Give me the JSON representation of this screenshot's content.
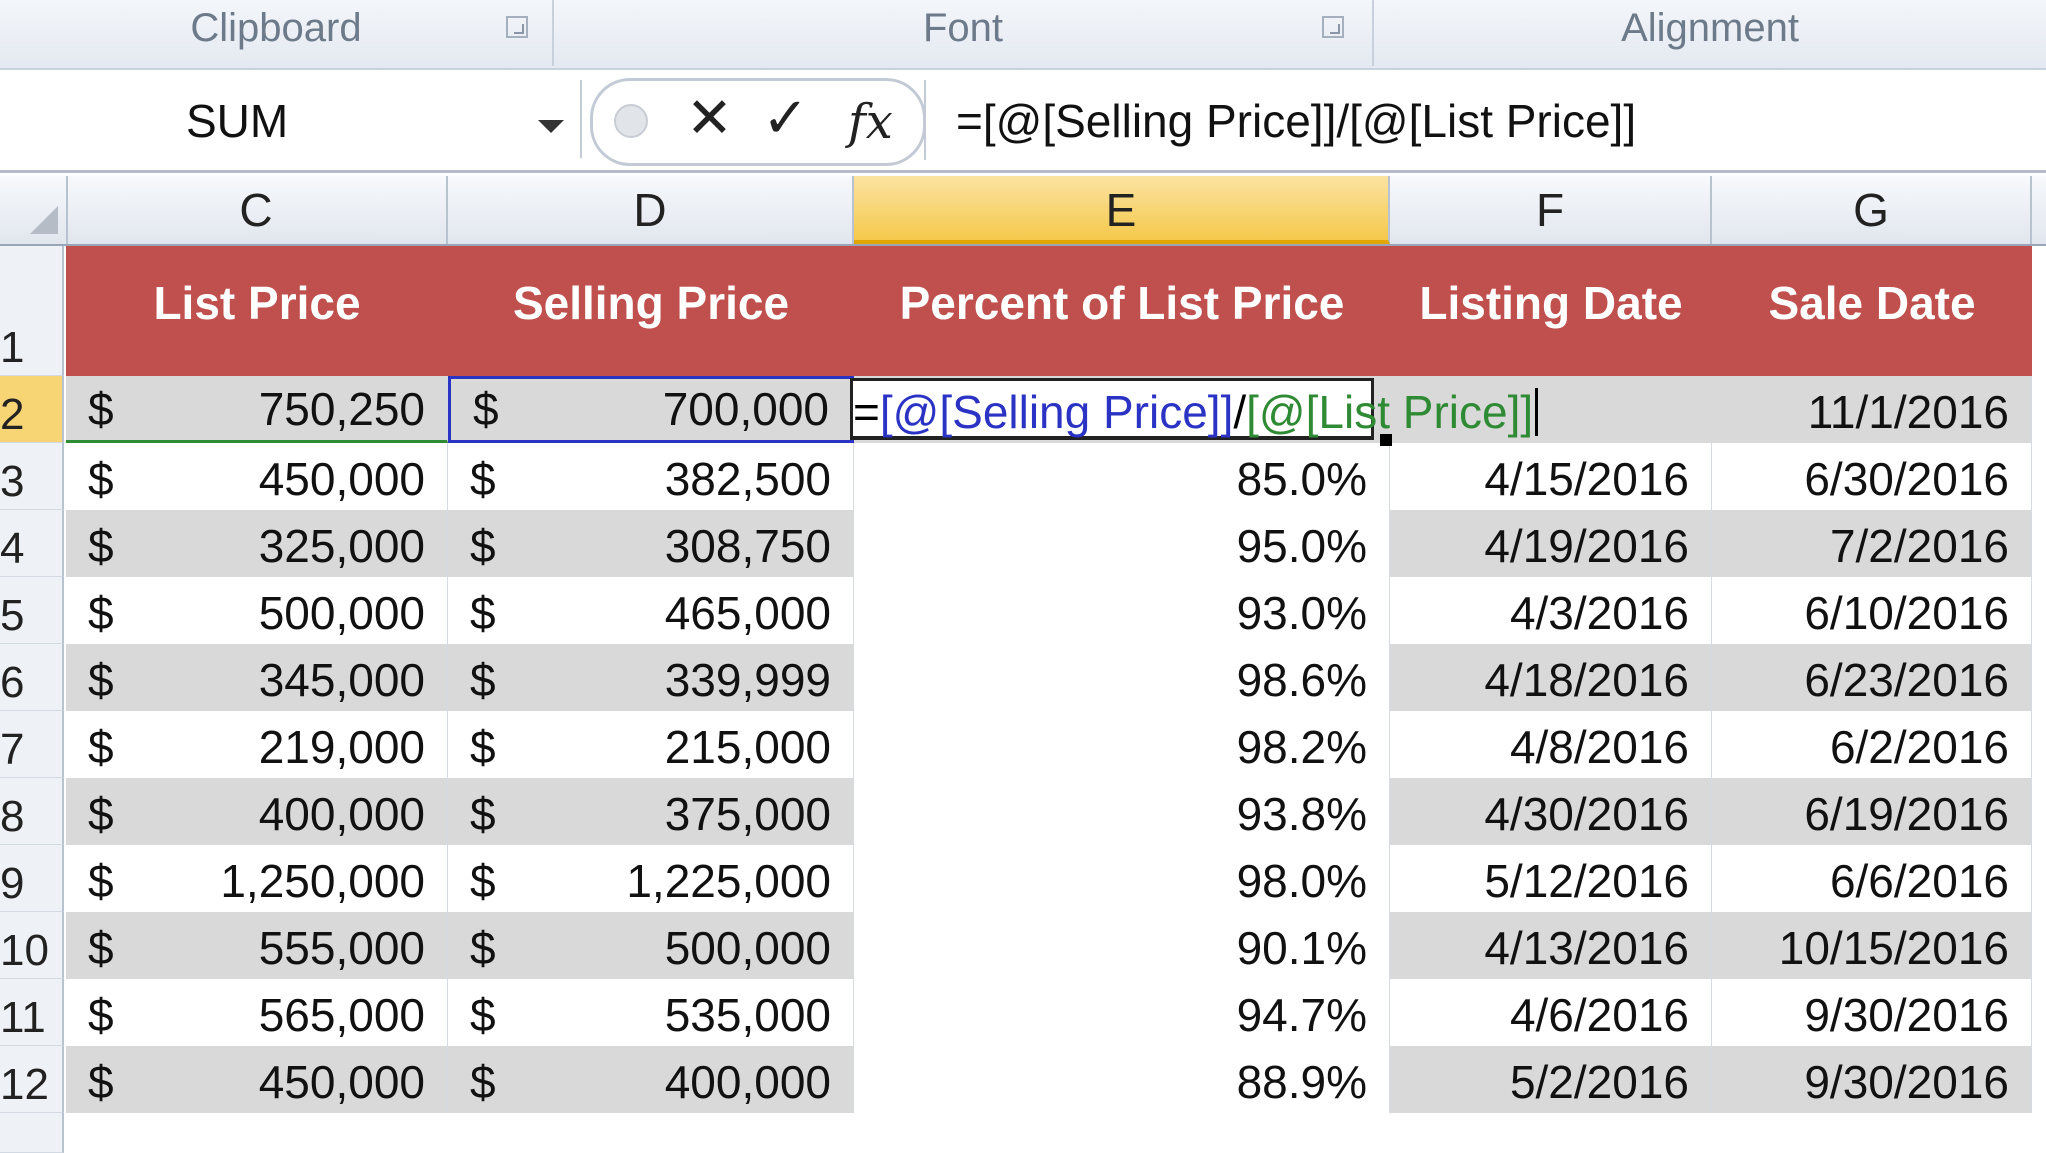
{
  "ribbon": {
    "groups": [
      {
        "label": "Clipboard"
      },
      {
        "label": "Font"
      },
      {
        "label": "Alignment"
      }
    ]
  },
  "formula_bar": {
    "name_box": "SUM",
    "cancel_symbol": "✕",
    "enter_symbol": "✓",
    "fx_symbol": "fx",
    "formula": "=[@[Selling Price]]/[@[List Price]]"
  },
  "columns": [
    "C",
    "D",
    "E",
    "F",
    "G"
  ],
  "active_column": "E",
  "table": {
    "header_color": "#c0504d",
    "band_color": "#d9d9d9",
    "headers": [
      "List Price",
      "Selling Price",
      "Percent of List Price",
      "Listing Date",
      "Sale Date"
    ],
    "edit_cell": {
      "eq": "=",
      "ref1": "[@[Selling Price]]",
      "div": "/",
      "ref2": "[@[List Price]]"
    },
    "rows": [
      {
        "row": "2",
        "list": "750,250",
        "selling": "700,000",
        "pct": "",
        "listing": "",
        "sale": "11/1/2016"
      },
      {
        "row": "3",
        "list": "450,000",
        "selling": "382,500",
        "pct": "85.0%",
        "listing": "4/15/2016",
        "sale": "6/30/2016"
      },
      {
        "row": "4",
        "list": "325,000",
        "selling": "308,750",
        "pct": "95.0%",
        "listing": "4/19/2016",
        "sale": "7/2/2016"
      },
      {
        "row": "5",
        "list": "500,000",
        "selling": "465,000",
        "pct": "93.0%",
        "listing": "4/3/2016",
        "sale": "6/10/2016"
      },
      {
        "row": "6",
        "list": "345,000",
        "selling": "339,999",
        "pct": "98.6%",
        "listing": "4/18/2016",
        "sale": "6/23/2016"
      },
      {
        "row": "7",
        "list": "219,000",
        "selling": "215,000",
        "pct": "98.2%",
        "listing": "4/8/2016",
        "sale": "6/2/2016"
      },
      {
        "row": "8",
        "list": "400,000",
        "selling": "375,000",
        "pct": "93.8%",
        "listing": "4/30/2016",
        "sale": "6/19/2016"
      },
      {
        "row": "9",
        "list": "1,250,000",
        "selling": "1,225,000",
        "pct": "98.0%",
        "listing": "5/12/2016",
        "sale": "6/6/2016"
      },
      {
        "row": "10",
        "list": "555,000",
        "selling": "500,000",
        "pct": "90.1%",
        "listing": "4/13/2016",
        "sale": "10/15/2016"
      },
      {
        "row": "11",
        "list": "565,000",
        "selling": "535,000",
        "pct": "94.7%",
        "listing": "4/6/2016",
        "sale": "9/30/2016"
      },
      {
        "row": "12",
        "list": "450,000",
        "selling": "400,000",
        "pct": "88.9%",
        "listing": "5/2/2016",
        "sale": "9/30/2016"
      }
    ],
    "currency": "$"
  }
}
